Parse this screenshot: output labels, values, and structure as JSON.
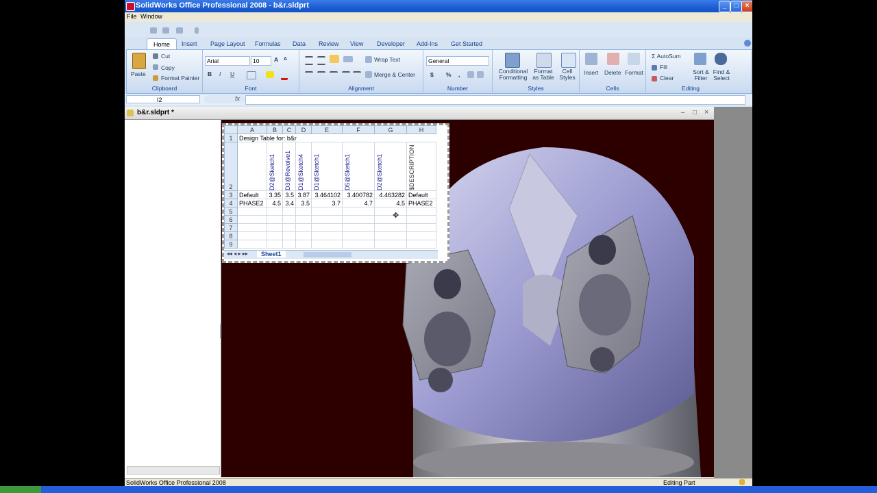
{
  "window": {
    "title": "SolidWorks Office Professional 2008 - b&r.sldprt",
    "min": "_",
    "max": "□",
    "close": "×"
  },
  "menu": {
    "file": "File",
    "window": "Window"
  },
  "ribbon_tabs": [
    "Home",
    "Insert",
    "Page Layout",
    "Formulas",
    "Data",
    "Review",
    "View",
    "Developer",
    "Add-Ins",
    "Get Started"
  ],
  "clipboard": {
    "paste": "Paste",
    "cut": "Cut",
    "copy": "Copy",
    "format_painter": "Format Painter",
    "label": "Clipboard"
  },
  "font": {
    "name": "Arial",
    "size": "10",
    "bold": "B",
    "italic": "I",
    "underline": "U",
    "label": "Font"
  },
  "alignment": {
    "wrap": "Wrap Text",
    "merge": "Merge & Center",
    "label": "Alignment"
  },
  "number": {
    "format": "General",
    "currency": "$",
    "percent": "%",
    "comma": ",",
    "label": "Number"
  },
  "styles": {
    "conditional": "Conditional Formatting",
    "format_table": "Format as Table",
    "cell_styles": "Cell Styles",
    "label": "Styles"
  },
  "cells": {
    "insert": "Insert",
    "delete": "Delete",
    "format": "Format",
    "label": "Cells"
  },
  "editing": {
    "autosum": "AutoSum",
    "fill": "Fill",
    "clear": "Clear",
    "sort": "Sort & Filter",
    "find": "Find & Select",
    "label": "Editing"
  },
  "formula_bar": {
    "name_box": "I2",
    "fx": "fx",
    "value": ""
  },
  "document": {
    "title": "b&r.sldprt *"
  },
  "sheet": {
    "columns": [
      "A",
      "B",
      "C",
      "D",
      "E",
      "F",
      "G",
      "H"
    ],
    "row1": "Design Table for: b&r",
    "headers": [
      "D2@Sketch1",
      "D3@Revolve1",
      "D1@Sketch4",
      "D1@Sketch1",
      "D5@Sketch1",
      "D2@Sketch1",
      "$DESCRIPTION"
    ],
    "rows": [
      [
        "Default",
        "3.35",
        "3.5",
        "3.87",
        "3.464102",
        "3.400782",
        "4.463282",
        "Default"
      ],
      [
        "PHASE2",
        "4.5",
        "3.4",
        "3.5",
        "3.7",
        "4.7",
        "4.5",
        "PHASE2"
      ]
    ],
    "empty_rows": [
      "5",
      "6",
      "7",
      "8",
      "9"
    ],
    "tab": "Sheet1"
  },
  "status": {
    "left": "SolidWorks Office Professional 2008",
    "right": "Editing Part"
  }
}
